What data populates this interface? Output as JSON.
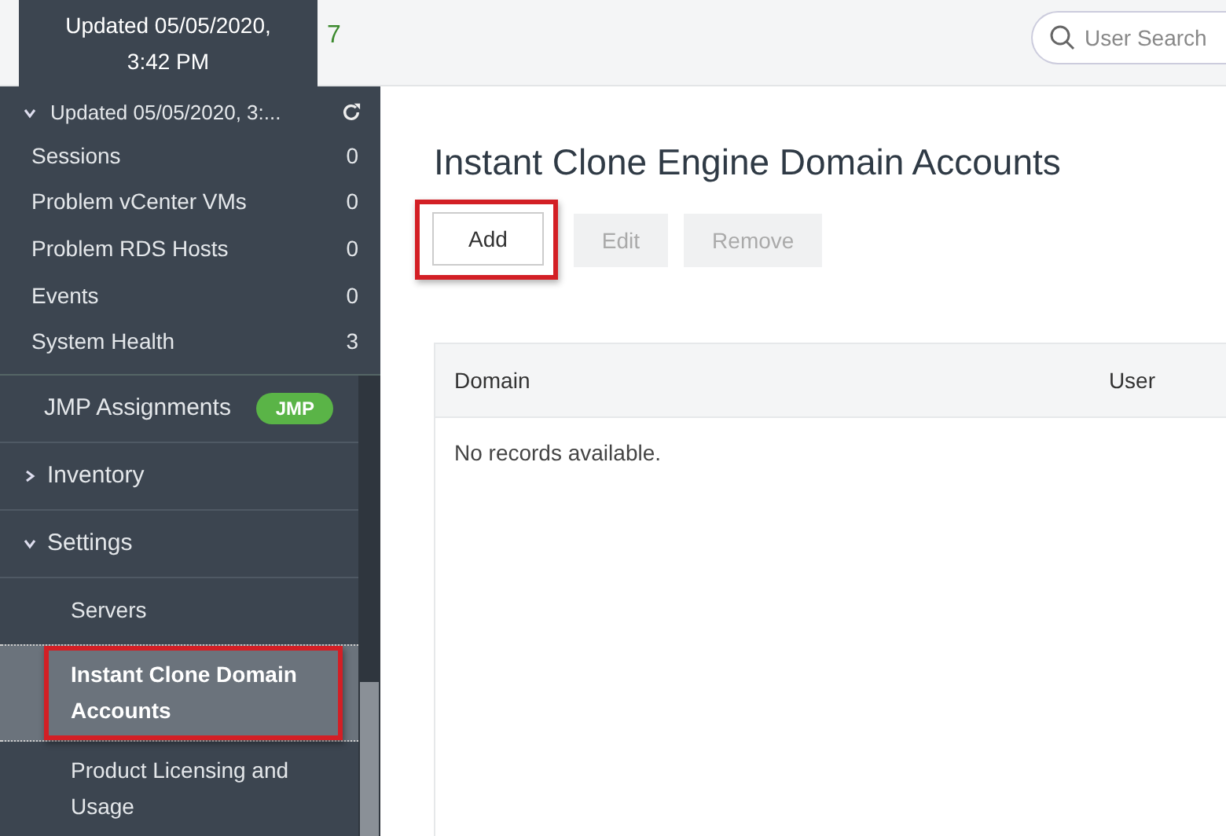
{
  "tooltip": {
    "text": "Updated 05/05/2020, 3:42 PM"
  },
  "header": {
    "count": "7",
    "search": {
      "placeholder": "User Search"
    }
  },
  "sidebar": {
    "status": {
      "label": "Updated 05/05/2020, 3:...",
      "expanded": true
    },
    "counters": [
      {
        "label": "Sessions",
        "value": "0"
      },
      {
        "label": "Problem vCenter VMs",
        "value": "0"
      },
      {
        "label": "Problem RDS Hosts",
        "value": "0"
      },
      {
        "label": "Events",
        "value": "0"
      },
      {
        "label": "System Health",
        "value": "3"
      }
    ],
    "nav": [
      {
        "label": "JMP Assignments",
        "badge": "JMP"
      },
      {
        "label": "Inventory",
        "expanded": false
      },
      {
        "label": "Settings",
        "expanded": true,
        "children": [
          {
            "label": "Servers",
            "selected": false,
            "highlighted": false
          },
          {
            "label": "Instant Clone Domain Accounts",
            "selected": true,
            "highlighted": true
          },
          {
            "label": "Product Licensing and Usage",
            "selected": false,
            "highlighted": false
          }
        ]
      }
    ]
  },
  "page": {
    "title": "Instant Clone Engine Domain Accounts",
    "buttons": [
      {
        "label": "Add",
        "disabled": false,
        "highlighted": true
      },
      {
        "label": "Edit",
        "disabled": true,
        "highlighted": false
      },
      {
        "label": "Remove",
        "disabled": true,
        "highlighted": false
      }
    ],
    "table": {
      "columns": [
        "Domain",
        "User"
      ],
      "empty_message": "No records available."
    }
  }
}
